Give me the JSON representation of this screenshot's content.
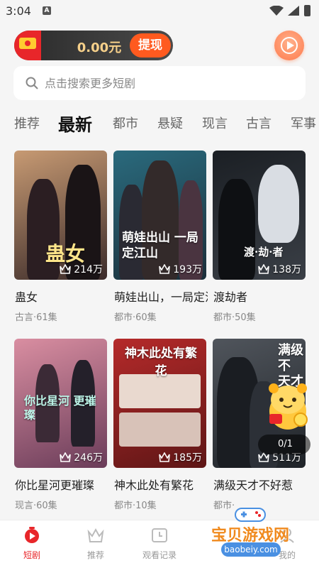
{
  "status": {
    "time": "3:04",
    "notif": "A"
  },
  "wallet": {
    "amount": "0.00元",
    "withdraw": "提现"
  },
  "search": {
    "placeholder": "点击搜索更多短剧"
  },
  "tabs": [
    {
      "label": "推荐"
    },
    {
      "label": "最新"
    },
    {
      "label": "都市"
    },
    {
      "label": "悬疑"
    },
    {
      "label": "现言"
    },
    {
      "label": "古言"
    },
    {
      "label": "军事"
    }
  ],
  "dramas": [
    {
      "title": "蛊女",
      "meta": "古言·61集",
      "views": "214万",
      "poster_text": "蛊女",
      "colors": [
        "#c79a73",
        "#3b2b2a"
      ]
    },
    {
      "title": "萌娃出山，一局定江山",
      "meta": "都市·60集",
      "views": "193万",
      "poster_text": "萌娃出山 一局定江山",
      "colors": [
        "#2a6a7d",
        "#1b2f3a"
      ]
    },
    {
      "title": "渡劫者",
      "meta": "都市·50集",
      "views": "138万",
      "poster_text": "渡·劫·者",
      "colors": [
        "#1b1f24",
        "#3a3f46"
      ]
    },
    {
      "title": "你比星河更璀璨",
      "meta": "现言·60集",
      "views": "246万",
      "poster_text": "你比星河 更璀璨",
      "colors": [
        "#d98ea1",
        "#6a3c59"
      ]
    },
    {
      "title": "神木此处有繁花",
      "meta": "都市·10集",
      "views": "185万",
      "poster_text": "神木此处有繁花",
      "colors": [
        "#b52a2a",
        "#5e1616"
      ]
    },
    {
      "title": "满级天才不好惹",
      "meta": "都市·",
      "views": "511万",
      "poster_text": "满级不 天才好",
      "colors": [
        "#50555c",
        "#1f2328"
      ]
    }
  ],
  "page_indicator": "0/1",
  "nav": [
    {
      "label": "短剧",
      "active": true
    },
    {
      "label": "推荐",
      "active": false
    },
    {
      "label": "观看记录",
      "active": false
    },
    {
      "label": "我的",
      "active": false
    }
  ],
  "watermark": {
    "text": "宝贝游戏网",
    "url": "baobeiy.com"
  },
  "colors": {
    "accent": "#e8262a",
    "withdraw": "#ff5a1f",
    "gold": "#f6d08a"
  }
}
